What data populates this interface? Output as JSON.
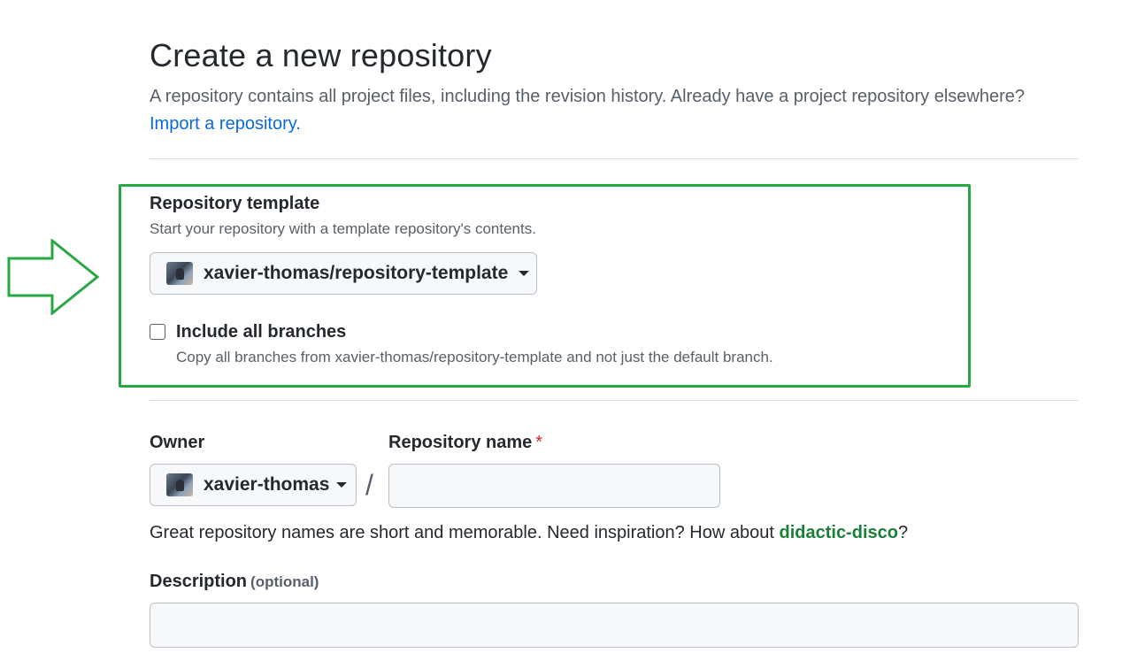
{
  "header": {
    "title": "Create a new repository",
    "subtitle": "A repository contains all project files, including the revision history. Already have a project repository elsewhere?",
    "import_link": "Import a repository."
  },
  "template_section": {
    "label": "Repository template",
    "note": "Start your repository with a template repository's contents.",
    "selected_template": "xavier-thomas/repository-template",
    "include_branches_label": "Include all branches",
    "include_branches_checked": false,
    "include_branches_note": "Copy all branches from xavier-thomas/repository-template and not just the default branch.",
    "highlight_color": "#28a745"
  },
  "owner": {
    "label": "Owner",
    "selected": "xavier-thomas"
  },
  "repo_name": {
    "label": "Repository name",
    "required_marker": "*",
    "separator": "/",
    "value": ""
  },
  "name_hint": {
    "prefix": "Great repository names are short and memorable. Need inspiration? How about ",
    "suggestion": "didactic-disco",
    "suffix": "?"
  },
  "description": {
    "label": "Description",
    "optional": "(optional)",
    "value": ""
  },
  "icons": {
    "avatar": "avatar",
    "dropdown": "caret-down-icon",
    "annotation": "arrow-right-outline-icon"
  }
}
